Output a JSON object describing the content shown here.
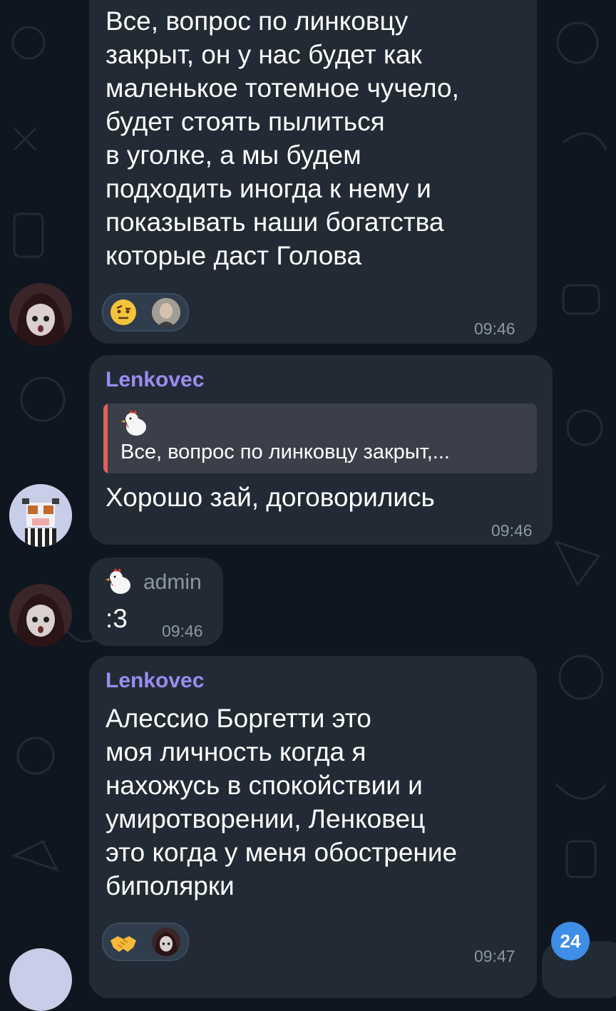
{
  "messages": [
    {
      "text": "Все, вопрос по линковцу\nзакрыт, он у нас будет как\nмаленькое тотемное чучело,\nбудет стоять пылиться\nв уголке, а мы будем\nподходить иногда к нему и\nпоказывать наши богатства\nкоторые даст Голова",
      "time": "09:46",
      "reactions": [
        "raised-eyebrow-emoji",
        "user-avatar-reaction"
      ]
    },
    {
      "sender": "Lenkovec",
      "quote": "Все, вопрос по линковцу закрыт,...",
      "text": "Хорошо зай, договорились",
      "time": "09:46"
    },
    {
      "sender_badge": "admin",
      "text": ":3",
      "time": "09:46"
    },
    {
      "sender": "Lenkovec",
      "text": "Алессио Боргетти это\nмоя личность когда я\nнахожусь в спокойствии и\nумиротворении, Ленковец\nэто когда у меня обострение\nбиполярки",
      "time": "09:47",
      "reactions": [
        "handshake-emoji",
        "user-avatar-reaction"
      ]
    }
  ],
  "unread_count": "24",
  "colors": {
    "background": "#0e1620",
    "bubble": "#222b35",
    "sender_name": "#9b8cf0",
    "quote_bar": "#e0615c",
    "time": "#8d97a2",
    "unread_badge": "#3e8de6"
  }
}
